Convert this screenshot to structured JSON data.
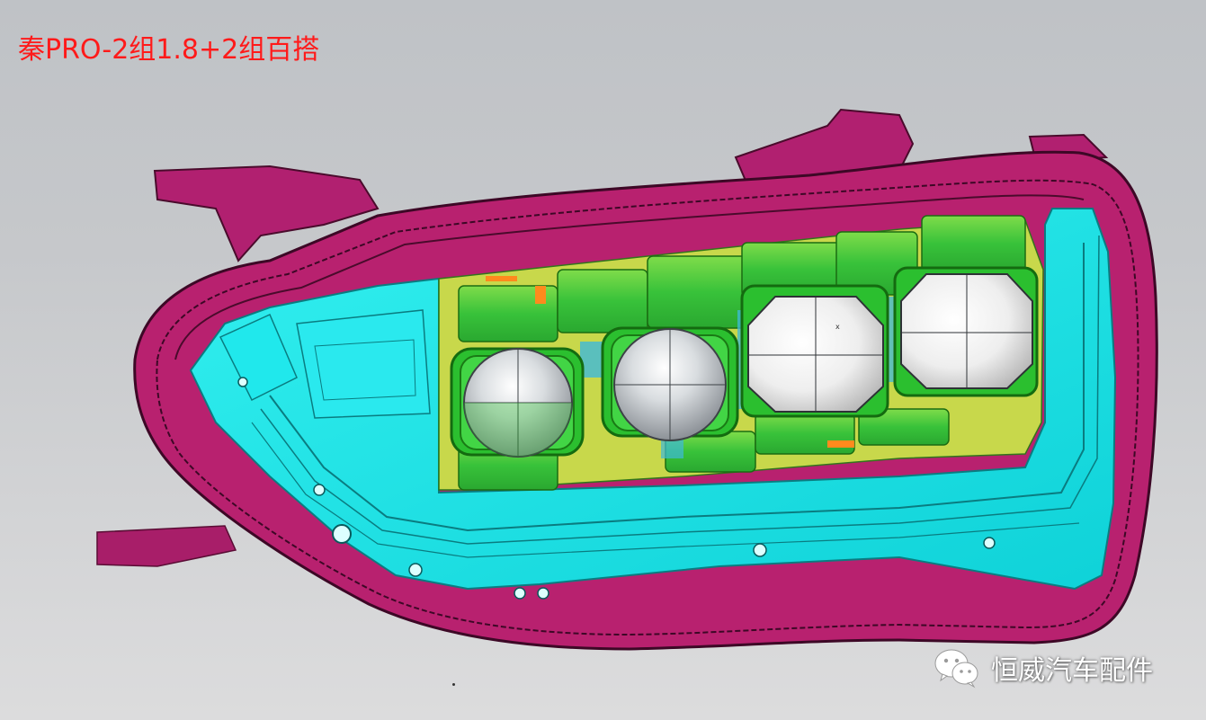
{
  "title": "秦PRO-2组1.8+2组百搭",
  "watermark": {
    "text": "恒威汽车配件",
    "icon": "wechat-icon"
  },
  "colors": {
    "housing": "#b5206f",
    "bezel": "#13e6e6",
    "reflector": "#4fcf3a",
    "lens": "#d8d8d8",
    "title": "#ff1a1a",
    "background": "#c8c9cc"
  }
}
